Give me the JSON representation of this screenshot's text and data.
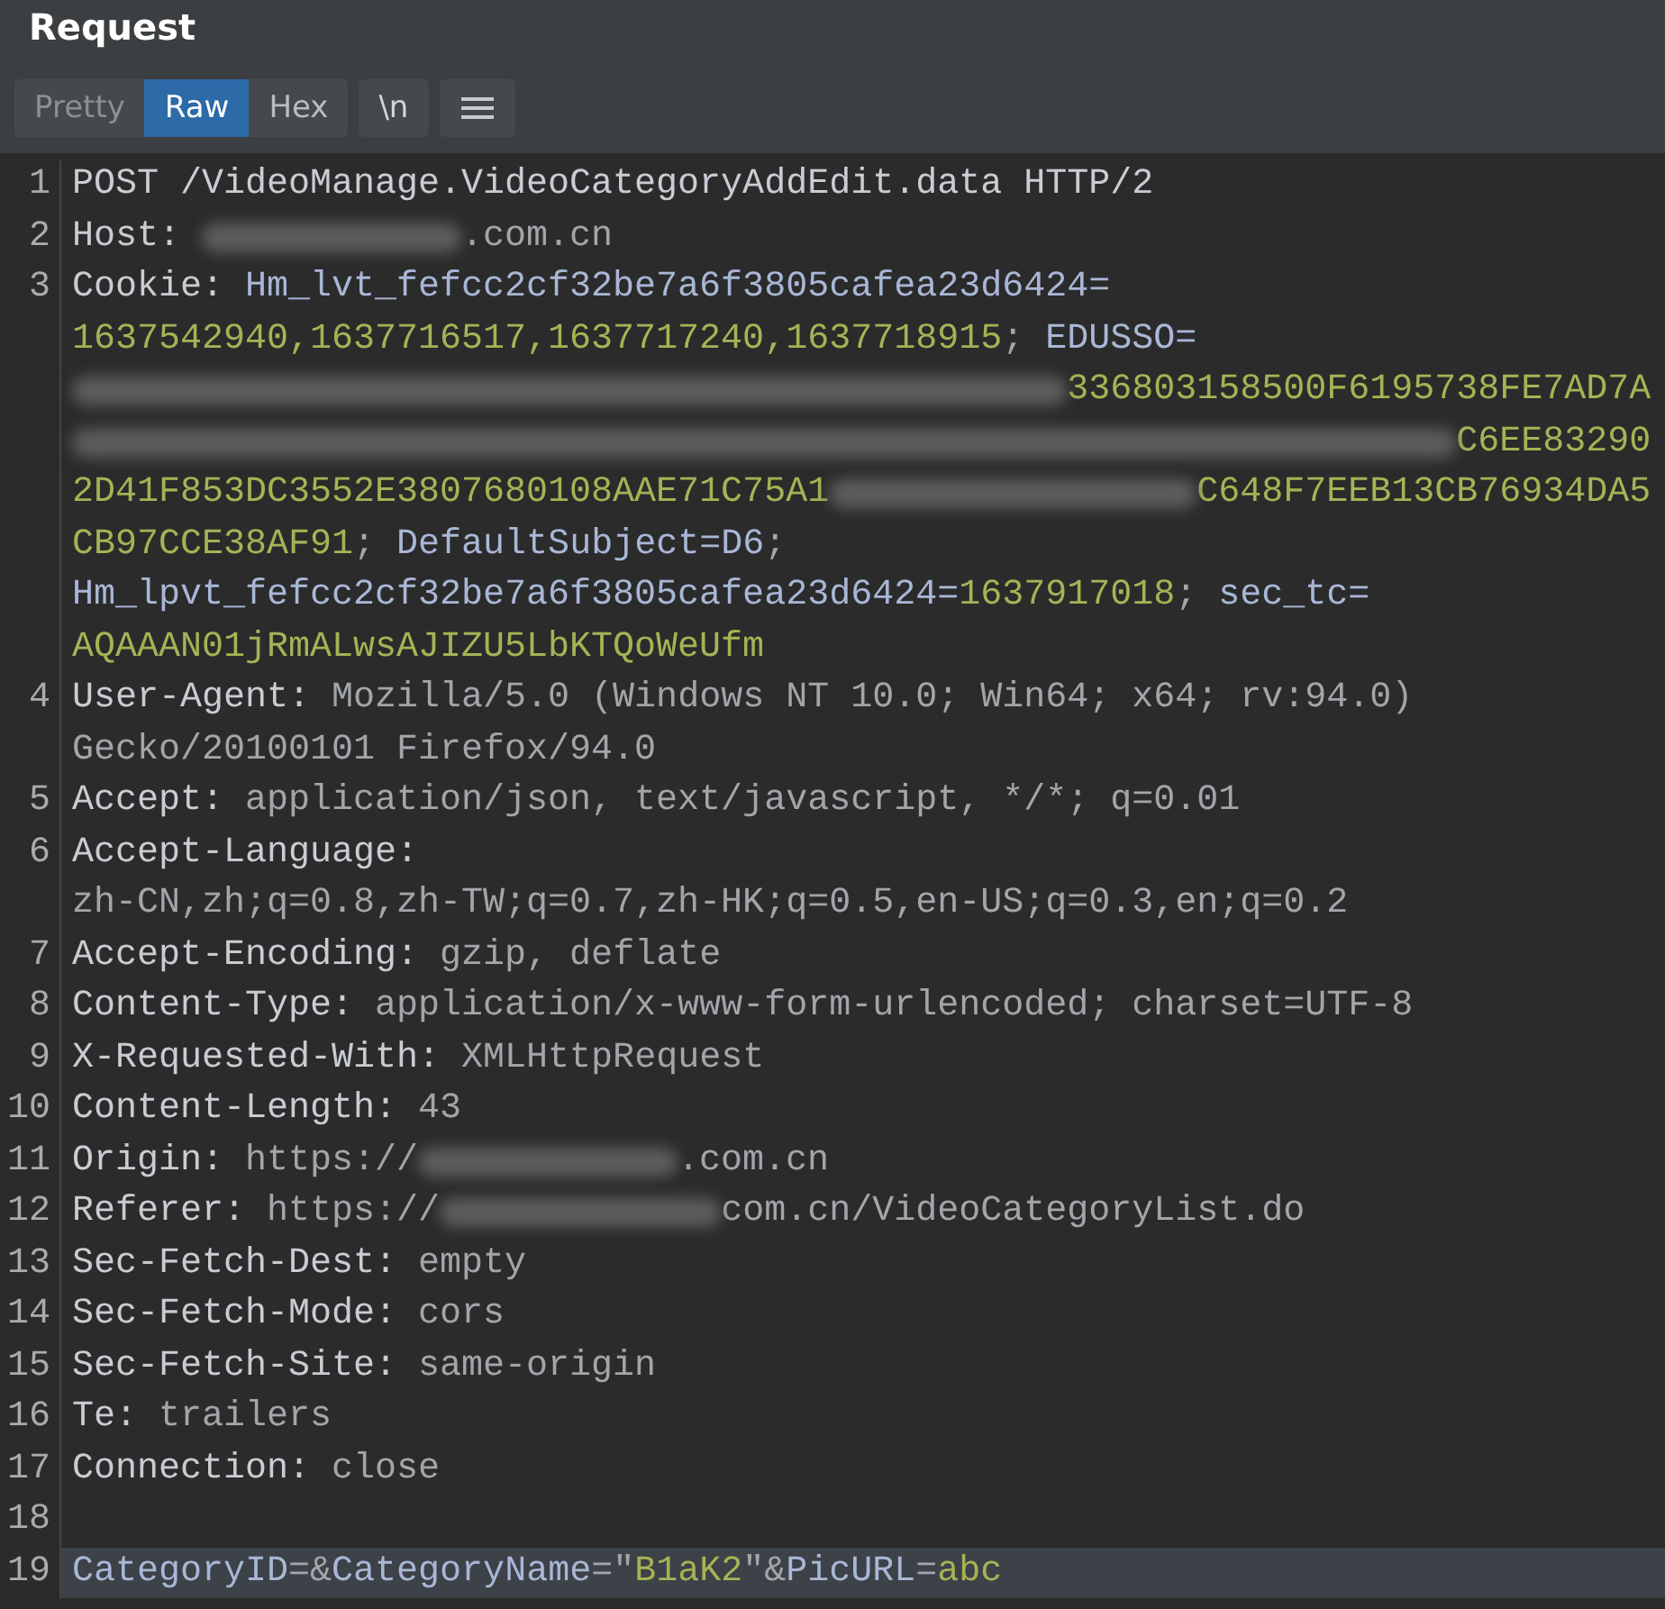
{
  "panel": {
    "title": "Request"
  },
  "toolbar": {
    "tabs": [
      {
        "label": "Pretty",
        "selected": false
      },
      {
        "label": "Raw",
        "selected": true
      },
      {
        "label": "Hex",
        "selected": false
      }
    ],
    "buttons": [
      "\\n"
    ]
  },
  "editor": {
    "lines": [
      {
        "number": "1",
        "selected": false,
        "runs": [
          {
            "kind": "key",
            "text": "POST /VideoManage.VideoCategoryAddEdit.data HTTP/2"
          }
        ]
      },
      {
        "number": "2",
        "selected": false,
        "runs": [
          {
            "kind": "key",
            "text": "Host: "
          },
          {
            "kind": "redacted"
          },
          {
            "kind": "text",
            "text": ".com.cn"
          }
        ]
      },
      {
        "number": "3",
        "selected": false,
        "runs": [
          {
            "kind": "key",
            "text": "Cookie: "
          },
          {
            "kind": "param",
            "text": "Hm_lvt_fefcc2cf32be7a6f3805cafea23d6424="
          },
          {
            "kind": "break"
          },
          {
            "kind": "value",
            "text": "1637542940,1637716517,1637717240,1637718915"
          },
          {
            "kind": "text",
            "text": "; "
          },
          {
            "kind": "param",
            "text": "EDUSSO="
          },
          {
            "kind": "break"
          },
          {
            "kind": "redacted"
          },
          {
            "kind": "value",
            "text": "336803158500F6195738FE7AD7A"
          },
          {
            "kind": "break"
          },
          {
            "kind": "redacted"
          },
          {
            "kind": "value",
            "text": "C6EE83290"
          },
          {
            "kind": "break"
          },
          {
            "kind": "value",
            "text": "2D41F853DC3552E3807680108AAE71C75A1"
          },
          {
            "kind": "redacted"
          },
          {
            "kind": "value",
            "text": "C648F7EEB13CB76934DA5"
          },
          {
            "kind": "break"
          },
          {
            "kind": "value",
            "text": "CB97CCE38AF91"
          },
          {
            "kind": "text",
            "text": "; "
          },
          {
            "kind": "param",
            "text": "DefaultSubject=D6"
          },
          {
            "kind": "text",
            "text": ";"
          },
          {
            "kind": "break"
          },
          {
            "kind": "param",
            "text": "Hm_lpvt_fefcc2cf32be7a6f3805cafea23d6424="
          },
          {
            "kind": "value",
            "text": "1637917018"
          },
          {
            "kind": "text",
            "text": "; "
          },
          {
            "kind": "param",
            "text": "sec_tc="
          },
          {
            "kind": "break"
          },
          {
            "kind": "value",
            "text": "AQAAAN01jRmALwsAJIZU5LbKTQoWeUfm"
          }
        ]
      },
      {
        "number": "4",
        "selected": false,
        "runs": [
          {
            "kind": "key",
            "text": "User-Agent: "
          },
          {
            "kind": "text",
            "text": "Mozilla/5.0 (Windows NT 10.0; Win64; x64; rv:94.0)"
          },
          {
            "kind": "break"
          },
          {
            "kind": "text",
            "text": "Gecko/20100101 Firefox/94.0"
          }
        ]
      },
      {
        "number": "5",
        "selected": false,
        "runs": [
          {
            "kind": "key",
            "text": "Accept: "
          },
          {
            "kind": "text",
            "text": "application/json, text/javascript, */*; q=0.01"
          }
        ]
      },
      {
        "number": "6",
        "selected": false,
        "runs": [
          {
            "kind": "key",
            "text": "Accept-Language:"
          },
          {
            "kind": "break"
          },
          {
            "kind": "text",
            "text": "zh-CN,zh;q=0.8,zh-TW;q=0.7,zh-HK;q=0.5,en-US;q=0.3,en;q=0.2"
          }
        ]
      },
      {
        "number": "7",
        "selected": false,
        "runs": [
          {
            "kind": "key",
            "text": "Accept-Encoding: "
          },
          {
            "kind": "text",
            "text": "gzip, deflate"
          }
        ]
      },
      {
        "number": "8",
        "selected": false,
        "runs": [
          {
            "kind": "key",
            "text": "Content-Type: "
          },
          {
            "kind": "text",
            "text": "application/x-www-form-urlencoded; charset=UTF-8"
          }
        ]
      },
      {
        "number": "9",
        "selected": false,
        "runs": [
          {
            "kind": "key",
            "text": "X-Requested-With: "
          },
          {
            "kind": "text",
            "text": "XMLHttpRequest"
          }
        ]
      },
      {
        "number": "10",
        "selected": false,
        "runs": [
          {
            "kind": "key",
            "text": "Content-Length: "
          },
          {
            "kind": "text",
            "text": "43"
          }
        ]
      },
      {
        "number": "11",
        "selected": false,
        "runs": [
          {
            "kind": "key",
            "text": "Origin: "
          },
          {
            "kind": "text",
            "text": "https://"
          },
          {
            "kind": "redacted"
          },
          {
            "kind": "text",
            "text": ".com.cn"
          }
        ]
      },
      {
        "number": "12",
        "selected": false,
        "runs": [
          {
            "kind": "key",
            "text": "Referer: "
          },
          {
            "kind": "text",
            "text": "https://"
          },
          {
            "kind": "redacted"
          },
          {
            "kind": "text",
            "text": "com.cn/VideoCategoryList.do"
          }
        ]
      },
      {
        "number": "13",
        "selected": false,
        "runs": [
          {
            "kind": "key",
            "text": "Sec-Fetch-Dest: "
          },
          {
            "kind": "text",
            "text": "empty"
          }
        ]
      },
      {
        "number": "14",
        "selected": false,
        "runs": [
          {
            "kind": "key",
            "text": "Sec-Fetch-Mode: "
          },
          {
            "kind": "text",
            "text": "cors"
          }
        ]
      },
      {
        "number": "15",
        "selected": false,
        "runs": [
          {
            "kind": "key",
            "text": "Sec-Fetch-Site: "
          },
          {
            "kind": "text",
            "text": "same-origin"
          }
        ]
      },
      {
        "number": "16",
        "selected": false,
        "runs": [
          {
            "kind": "key",
            "text": "Te: "
          },
          {
            "kind": "text",
            "text": "trailers"
          }
        ]
      },
      {
        "number": "17",
        "selected": false,
        "runs": [
          {
            "kind": "key",
            "text": "Connection: "
          },
          {
            "kind": "text",
            "text": "close"
          }
        ]
      },
      {
        "number": "18",
        "selected": false
      },
      {
        "number": "19",
        "selected": true,
        "runs": [
          {
            "kind": "param",
            "text": "CategoryID"
          },
          {
            "kind": "text",
            "text": "=&"
          },
          {
            "kind": "param",
            "text": "CategoryName"
          },
          {
            "kind": "text",
            "text": "=\""
          },
          {
            "kind": "value",
            "text": "B1aK2"
          },
          {
            "kind": "text",
            "text": "\"&"
          },
          {
            "kind": "param",
            "text": "PicURL"
          },
          {
            "kind": "text",
            "text": "="
          },
          {
            "kind": "value",
            "text": "abc"
          }
        ]
      }
    ]
  }
}
